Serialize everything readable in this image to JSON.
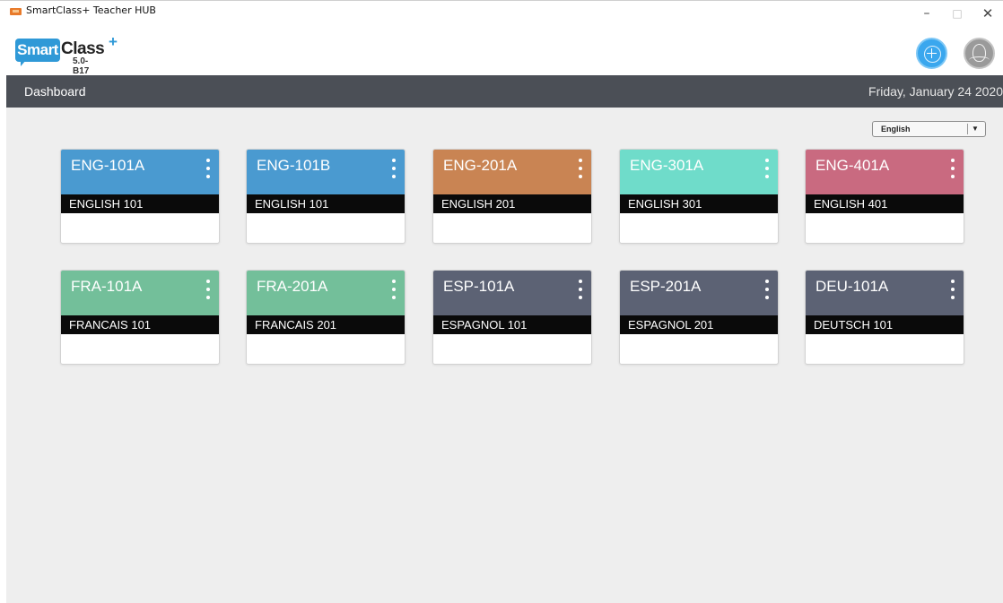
{
  "window": {
    "title": "SmartClass+ Teacher HUB",
    "controls": {
      "minimize": "–",
      "maximize": "□",
      "close": "✕"
    }
  },
  "header": {
    "logo": {
      "brand_a": "Smart",
      "brand_b": "Class",
      "plus": "+",
      "version": "5.0-B17"
    },
    "add_icon": "plus-circle-icon",
    "profile_icon": "user-profile-icon"
  },
  "navbar": {
    "title": "Dashboard",
    "date": "Friday, January 24 2020"
  },
  "language": {
    "selected": "English",
    "arrow": "▼"
  },
  "classes": [
    {
      "code": "ENG-101A",
      "name": "ENGLISH 101",
      "color": "#4a9ad0"
    },
    {
      "code": "ENG-101B",
      "name": "ENGLISH 101",
      "color": "#4a9ad0"
    },
    {
      "code": "ENG-201A",
      "name": "ENGLISH 201",
      "color": "#c98453"
    },
    {
      "code": "ENG-301A",
      "name": "ENGLISH 301",
      "color": "#6fdcca"
    },
    {
      "code": "ENG-401A",
      "name": "ENGLISH 401",
      "color": "#c96a80"
    },
    {
      "code": "FRA-101A",
      "name": "FRANCAIS 101",
      "color": "#73bf9a"
    },
    {
      "code": "FRA-201A",
      "name": "FRANCAIS 201",
      "color": "#73bf9a"
    },
    {
      "code": "ESP-101A",
      "name": "ESPAGNOL 101",
      "color": "#5c6274"
    },
    {
      "code": "ESP-201A",
      "name": "ESPAGNOL 201",
      "color": "#5c6274"
    },
    {
      "code": "DEU-101A",
      "name": "DEUTSCH 101",
      "color": "#5c6274"
    }
  ]
}
